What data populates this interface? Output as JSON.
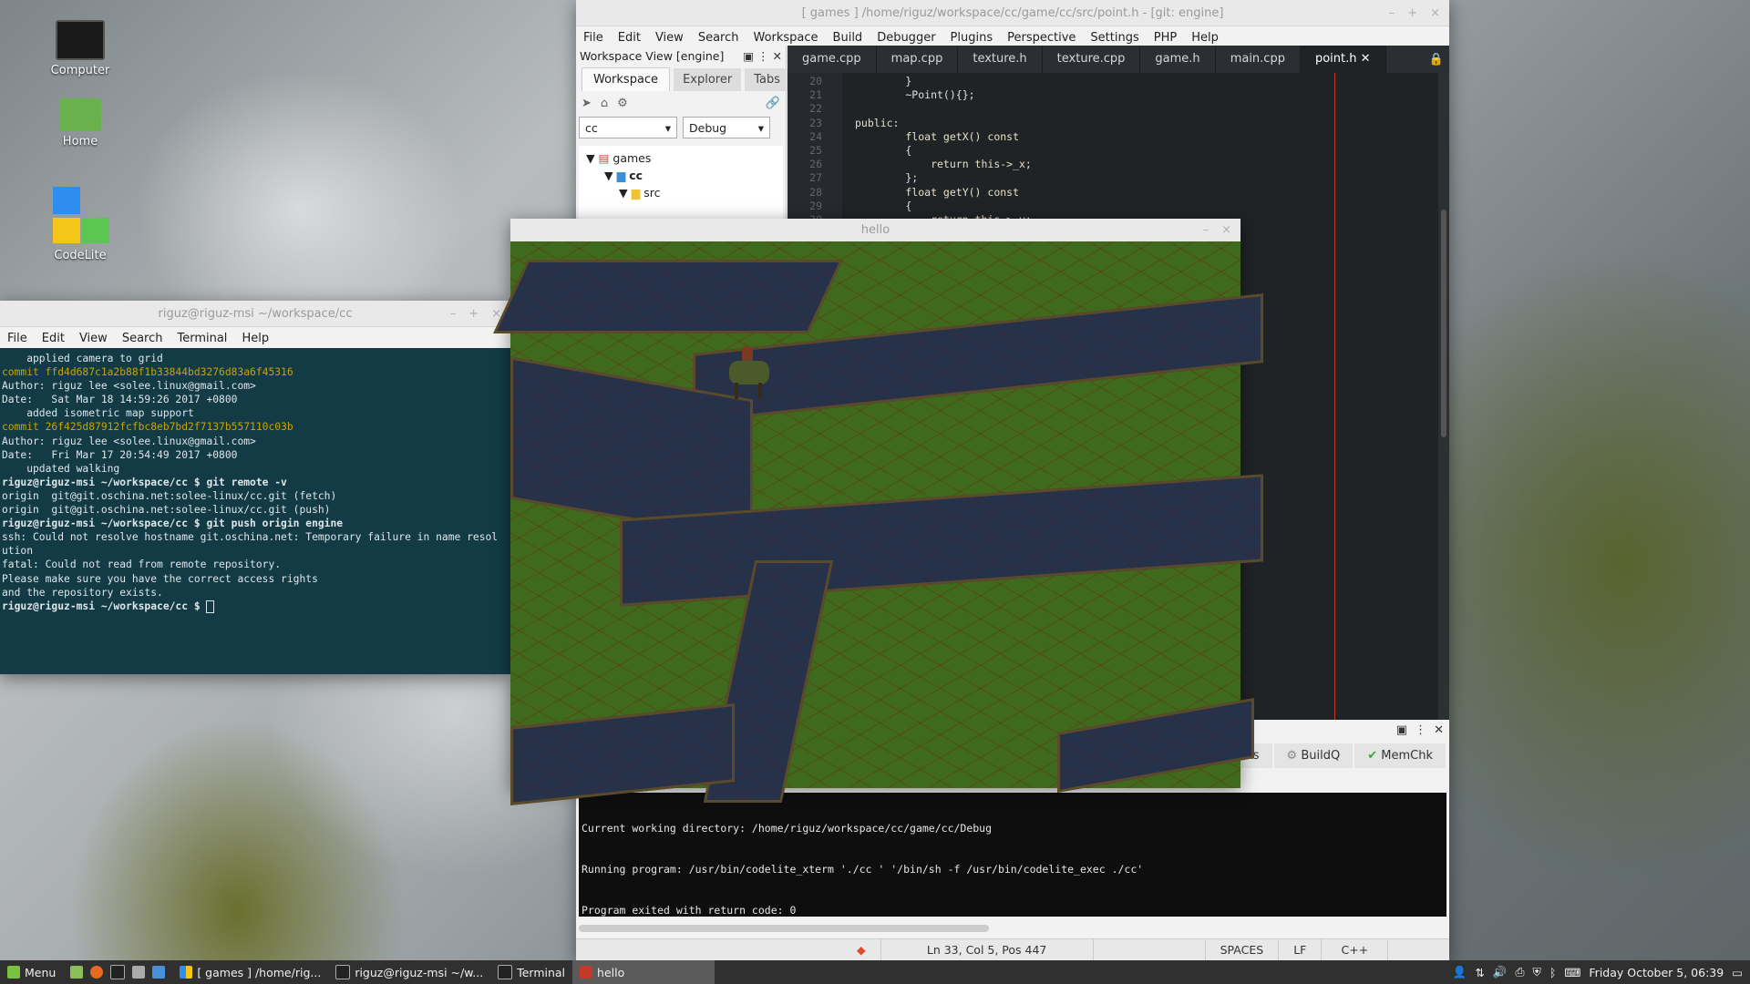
{
  "desktop": {
    "icons": [
      {
        "label": "Computer"
      },
      {
        "label": "Home"
      },
      {
        "label": "CodeLite"
      }
    ]
  },
  "ide": {
    "title": "[ games ] /home/riguz/workspace/cc/game/cc/src/point.h - [git: engine]",
    "menu": [
      "File",
      "Edit",
      "View",
      "Search",
      "Workspace",
      "Build",
      "Debugger",
      "Plugins",
      "Perspective",
      "Settings",
      "PHP",
      "Help"
    ],
    "workspace_view_title": "Workspace View [engine]",
    "panel_tabs": [
      "Workspace",
      "Explorer",
      "Tabs"
    ],
    "project_select": "cc",
    "config_select": "Debug",
    "tree": [
      {
        "label": "games"
      },
      {
        "label": "cc"
      },
      {
        "label": "src"
      }
    ],
    "editor_tabs": [
      "game.cpp",
      "map.cpp",
      "texture.h",
      "texture.cpp",
      "game.h",
      "main.cpp",
      "point.h"
    ],
    "active_tab": "point.h",
    "code_lines": [
      {
        "n": "20",
        "t": "        }"
      },
      {
        "n": "21",
        "t": "        ~Point(){};"
      },
      {
        "n": "22",
        "t": ""
      },
      {
        "n": "23",
        "t": "public:"
      },
      {
        "n": "24",
        "t": "        float getX() const"
      },
      {
        "n": "25",
        "t": "        {"
      },
      {
        "n": "26",
        "t": "            return this->_x;"
      },
      {
        "n": "27",
        "t": "        };"
      },
      {
        "n": "28",
        "t": "        float getY() const"
      },
      {
        "n": "29",
        "t": "        {"
      },
      {
        "n": "30",
        "t": "            return this->_y;"
      }
    ],
    "output_tabs": [
      "Tasks",
      "BuildQ",
      "MemChk"
    ],
    "output_lines": [
      "Current working directory: /home/riguz/workspace/cc/game/cc/Debug",
      "Running program: /usr/bin/codelite_xterm './cc ' '/bin/sh -f /usr/bin/codelite_exec ./cc'",
      "Program exited with return code: 0"
    ],
    "status": {
      "position": "Ln 33, Col 5, Pos 447",
      "indent": "SPACES",
      "eol": "LF",
      "lang": "C++"
    }
  },
  "terminal": {
    "title": "riguz@riguz-msi ~/workspace/cc",
    "menu": [
      "File",
      "Edit",
      "View",
      "Search",
      "Terminal",
      "Help"
    ],
    "lines": [
      {
        "c": "",
        "t": "    applied camera to grid"
      },
      {
        "c": "",
        "t": ""
      },
      {
        "c": "y",
        "t": "commit ffd4d687c1a2b88f1b33844bd3276d83a6f45316"
      },
      {
        "c": "",
        "t": "Author: riguz lee <solee.linux@gmail.com>"
      },
      {
        "c": "",
        "t": "Date:   Sat Mar 18 14:59:26 2017 +0800"
      },
      {
        "c": "",
        "t": ""
      },
      {
        "c": "",
        "t": "    added isometric map support"
      },
      {
        "c": "",
        "t": ""
      },
      {
        "c": "y",
        "t": "commit 26f425d87912fcfbc8eb7bd2f7137b557110c03b"
      },
      {
        "c": "",
        "t": "Author: riguz lee <solee.linux@gmail.com>"
      },
      {
        "c": "",
        "t": "Date:   Fri Mar 17 20:54:49 2017 +0800"
      },
      {
        "c": "",
        "t": ""
      },
      {
        "c": "",
        "t": "    updated walking"
      },
      {
        "c": "p",
        "t": "riguz@riguz-msi ~/workspace/cc $ git remote -v"
      },
      {
        "c": "",
        "t": "origin  git@git.oschina.net:solee-linux/cc.git (fetch)"
      },
      {
        "c": "",
        "t": "origin  git@git.oschina.net:solee-linux/cc.git (push)"
      },
      {
        "c": "p",
        "t": "riguz@riguz-msi ~/workspace/cc $ git push origin engine"
      },
      {
        "c": "",
        "t": "ssh: Could not resolve hostname git.oschina.net: Temporary failure in name resol"
      },
      {
        "c": "",
        "t": "ution"
      },
      {
        "c": "",
        "t": "fatal: Could not read from remote repository."
      },
      {
        "c": "",
        "t": ""
      },
      {
        "c": "",
        "t": "Please make sure you have the correct access rights"
      },
      {
        "c": "",
        "t": "and the repository exists."
      },
      {
        "c": "p",
        "t": "riguz@riguz-msi ~/workspace/cc $ "
      }
    ]
  },
  "game": {
    "title": "hello"
  },
  "taskbar": {
    "menu_label": "Menu",
    "items": [
      "[ games ] /home/rig...",
      "riguz@riguz-msi ~/w...",
      "Terminal",
      "hello"
    ],
    "active_item": "hello",
    "clock": "Friday October 5, 06:39"
  },
  "colors": {
    "terminal_bg": "#123b46",
    "editor_bg": "#1f2326",
    "taskbar_bg": "#303030",
    "commit_yellow": "#c9a400"
  }
}
